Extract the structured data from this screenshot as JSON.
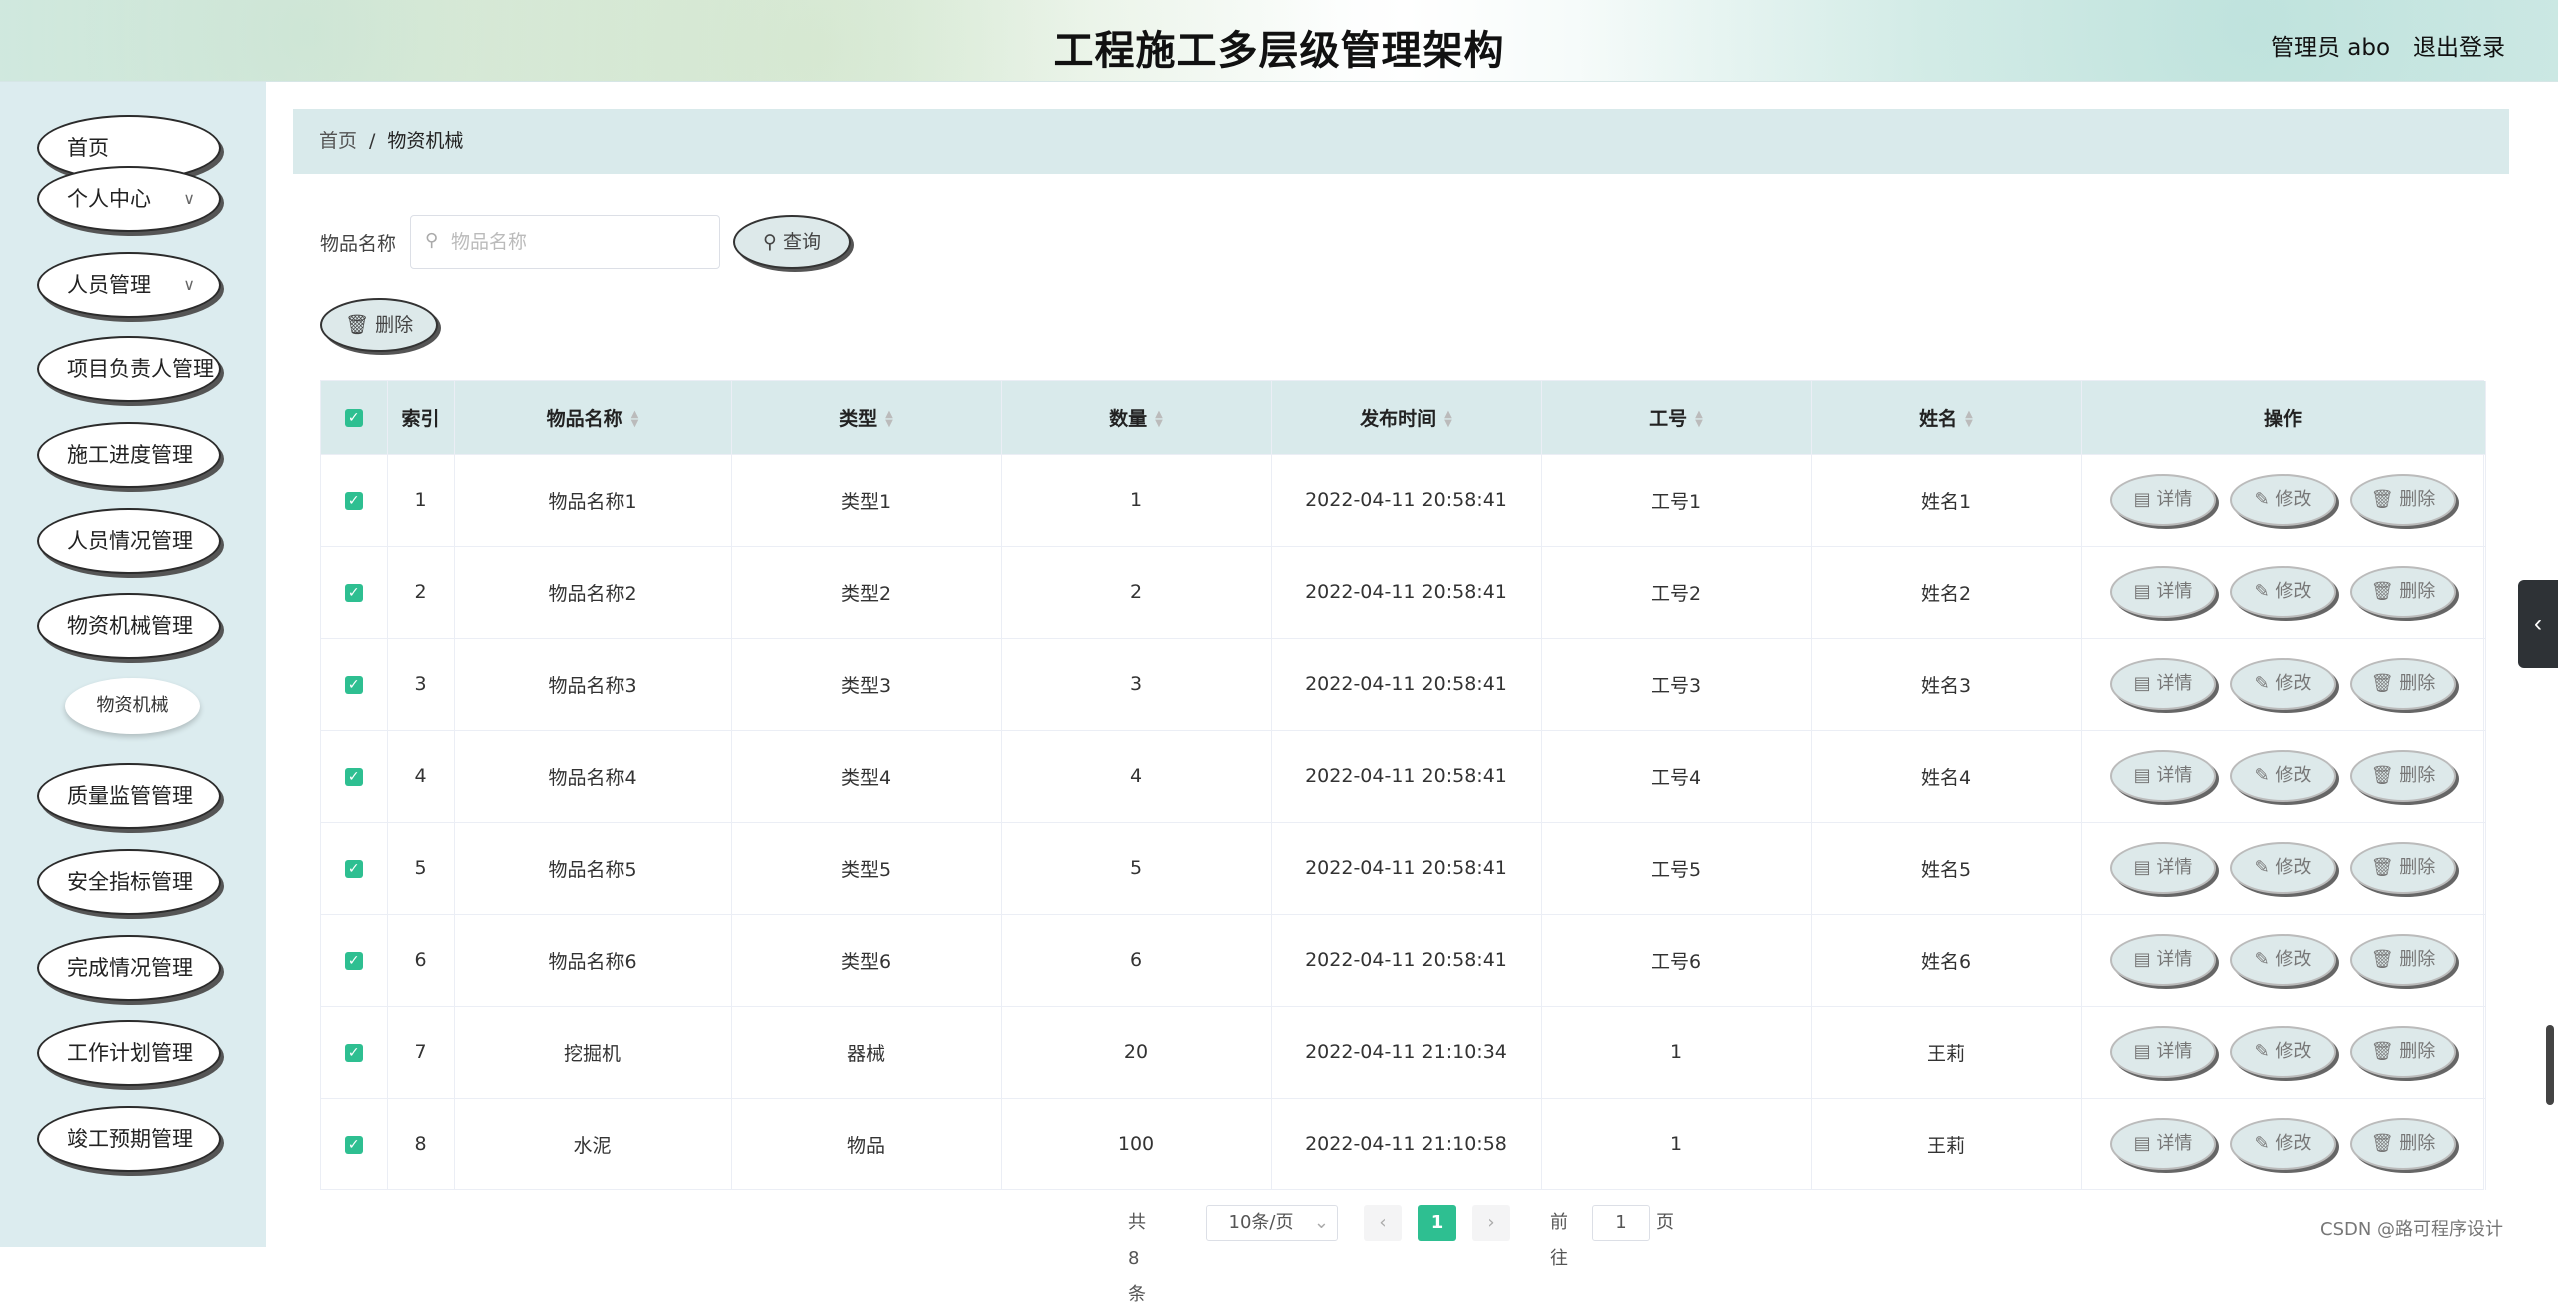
{
  "header": {
    "title": "工程施工多层级管理架构",
    "user_label": "管理员 abo",
    "logout": "退出登录"
  },
  "sidebar": {
    "items": [
      {
        "label": "首页",
        "has_chevron": false
      },
      {
        "label": "个人中心",
        "has_chevron": true
      },
      {
        "label": "人员管理",
        "has_chevron": true
      },
      {
        "label": "项目负责人管理",
        "has_chevron": false
      },
      {
        "label": "施工进度管理",
        "has_chevron": false
      },
      {
        "label": "人员情况管理",
        "has_chevron": false
      },
      {
        "label": "物资机械管理",
        "has_chevron": false
      },
      {
        "label": "质量监管管理",
        "has_chevron": false
      },
      {
        "label": "安全指标管理",
        "has_chevron": false
      },
      {
        "label": "完成情况管理",
        "has_chevron": false
      },
      {
        "label": "工作计划管理",
        "has_chevron": false
      },
      {
        "label": "竣工预期管理",
        "has_chevron": false
      }
    ],
    "submenu": "物资机械"
  },
  "breadcrumb": {
    "home": "首页",
    "sep": "/",
    "current": "物资机械"
  },
  "search": {
    "label": "物品名称",
    "placeholder": "物品名称",
    "value": "",
    "button": "查询"
  },
  "toolbar": {
    "delete": "删除"
  },
  "table": {
    "columns": [
      "索引",
      "物品名称",
      "类型",
      "数量",
      "发布时间",
      "工号",
      "姓名",
      "操作"
    ],
    "rows": [
      {
        "index": "1",
        "name": "物品名称1",
        "type": "类型1",
        "qty": "1",
        "time": "2022-04-11 20:58:41",
        "no": "工号1",
        "person": "姓名1"
      },
      {
        "index": "2",
        "name": "物品名称2",
        "type": "类型2",
        "qty": "2",
        "time": "2022-04-11 20:58:41",
        "no": "工号2",
        "person": "姓名2"
      },
      {
        "index": "3",
        "name": "物品名称3",
        "type": "类型3",
        "qty": "3",
        "time": "2022-04-11 20:58:41",
        "no": "工号3",
        "person": "姓名3"
      },
      {
        "index": "4",
        "name": "物品名称4",
        "type": "类型4",
        "qty": "4",
        "time": "2022-04-11 20:58:41",
        "no": "工号4",
        "person": "姓名4"
      },
      {
        "index": "5",
        "name": "物品名称5",
        "type": "类型5",
        "qty": "5",
        "time": "2022-04-11 20:58:41",
        "no": "工号5",
        "person": "姓名5"
      },
      {
        "index": "6",
        "name": "物品名称6",
        "type": "类型6",
        "qty": "6",
        "time": "2022-04-11 20:58:41",
        "no": "工号6",
        "person": "姓名6"
      },
      {
        "index": "7",
        "name": "挖掘机",
        "type": "器械",
        "qty": "20",
        "time": "2022-04-11 21:10:34",
        "no": "1",
        "person": "王莉"
      },
      {
        "index": "8",
        "name": "水泥",
        "type": "物品",
        "qty": "100",
        "time": "2022-04-11 21:10:58",
        "no": "1",
        "person": "王莉"
      }
    ],
    "actions": {
      "detail": "详情",
      "edit": "修改",
      "delete": "删除"
    }
  },
  "pagination": {
    "total": "共 8 条",
    "page_size": "10条/页",
    "current": "1",
    "goto_prefix": "前往",
    "goto_value": "1",
    "goto_suffix": "页"
  },
  "watermark": "CSDN @路可程序设计",
  "colors": {
    "accent": "#2ebf91",
    "header_bg": "#d9eaeb",
    "sidebar_bg": "#dcecef"
  }
}
